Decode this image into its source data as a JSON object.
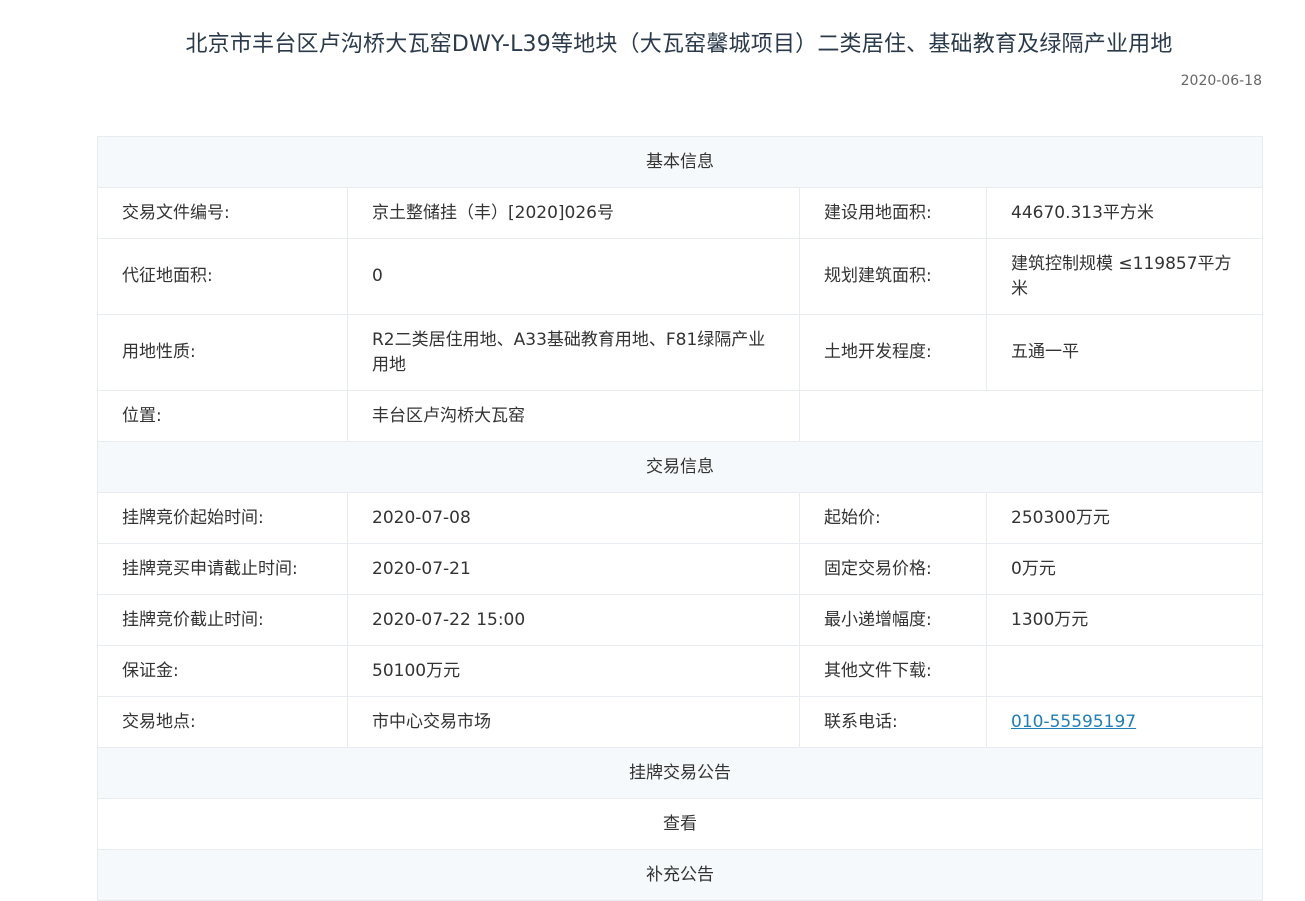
{
  "header": {
    "title": "北京市丰台区卢沟桥大瓦窑DWY-L39等地块（大瓦窑馨城项目）二类居住、基础教育及绿隔产业用地",
    "date": "2020-06-18"
  },
  "basic": {
    "heading": "基本信息",
    "file_no_label": "交易文件编号:",
    "file_no": "京土整储挂（丰）[2020]026号",
    "build_area_label": "建设用地面积:",
    "build_area": "44670.313平方米",
    "levy_area_label": "代征地面积:",
    "levy_area": "0",
    "plan_area_label": "规划建筑面积:",
    "plan_area": "建筑控制规模 ≤119857平方米",
    "land_use_label": "用地性质:",
    "land_use": "R2二类居住用地、A33基础教育用地、F81绿隔产业用地",
    "dev_level_label": "土地开发程度:",
    "dev_level": "五通一平",
    "location_label": "位置:",
    "location": "丰台区卢沟桥大瓦窑"
  },
  "trade": {
    "heading": "交易信息",
    "start_time_label": "挂牌竞价起始时间:",
    "start_time": "2020-07-08",
    "start_price_label": "起始价:",
    "start_price": "250300万元",
    "apply_deadline_label": "挂牌竞买申请截止时间:",
    "apply_deadline": "2020-07-21",
    "fixed_price_label": "固定交易价格:",
    "fixed_price": "0万元",
    "bid_deadline_label": "挂牌竞价截止时间:",
    "bid_deadline": "2020-07-22 15:00",
    "min_increment_label": "最小递增幅度:",
    "min_increment": "1300万元",
    "deposit_label": "保证金:",
    "deposit": "50100万元",
    "other_files_label": "其他文件下载:",
    "other_files": "",
    "venue_label": "交易地点:",
    "venue": "市中心交易市场",
    "phone_label": "联系电话:",
    "phone": "010-55595197"
  },
  "notice": {
    "heading": "挂牌交易公告",
    "view_label": "查看"
  },
  "supplement": {
    "heading": "补充公告"
  }
}
